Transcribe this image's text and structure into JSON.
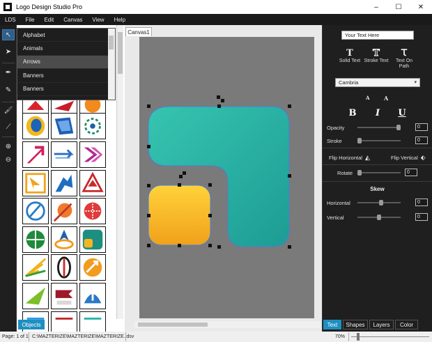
{
  "window": {
    "title": "Logo Design Studio Pro",
    "controls": [
      "–",
      "☐",
      "✕"
    ]
  },
  "menu": [
    "LDS",
    "File",
    "Edit",
    "Canvas",
    "View",
    "Help"
  ],
  "tools": [
    "pointer-icon",
    "select-icon",
    "pen-icon",
    "pencil-icon",
    "brush-icon",
    "wand-icon",
    "zoom-in-icon",
    "zoom-out-icon"
  ],
  "library": {
    "category_dropdown": {
      "options": [
        "Alphabet",
        "Animals",
        "Arrows",
        "Banners",
        "Banners"
      ],
      "selected": "Arrows"
    },
    "tab": "Objects"
  },
  "canvas": {
    "tab": "Canvas1"
  },
  "properties": {
    "text_value": "Your Text Here",
    "text_modes": [
      {
        "label": "Solid Text",
        "icon": "solid-text-icon"
      },
      {
        "label": "Stroke Text",
        "icon": "stroke-text-icon"
      },
      {
        "label": "Text On Path",
        "icon": "text-on-path-icon"
      }
    ],
    "font": "Cambria",
    "styles": [
      "B",
      "I",
      "U"
    ],
    "opacity": {
      "label": "Opacity",
      "value": "0"
    },
    "stroke": {
      "label": "Stroke",
      "value": "0"
    },
    "flip_horizontal": "Flip Horizontal",
    "flip_vertical": "Flip Vertical",
    "rotate": {
      "label": "Rotate",
      "value": "0"
    },
    "skew": {
      "title": "Skew",
      "horizontal": {
        "label": "Horizontal",
        "value": "0"
      },
      "vertical": {
        "label": "Vertical",
        "value": "0"
      }
    },
    "tabs": [
      "Text",
      "Shapes",
      "Layers",
      "Color"
    ],
    "active_tab": "Text"
  },
  "status": {
    "page": "Page: 1 of 1",
    "path": "C:\\MAZTERIZE\\MAZTERIZE\\MAZTERIZE.ldsv",
    "zoom": "70%"
  },
  "colors": {
    "accent": "#1e8fc0",
    "teal": "#2bb4a6",
    "yellow": "#f5b522",
    "canvas_bg": "#7a7a7a"
  }
}
